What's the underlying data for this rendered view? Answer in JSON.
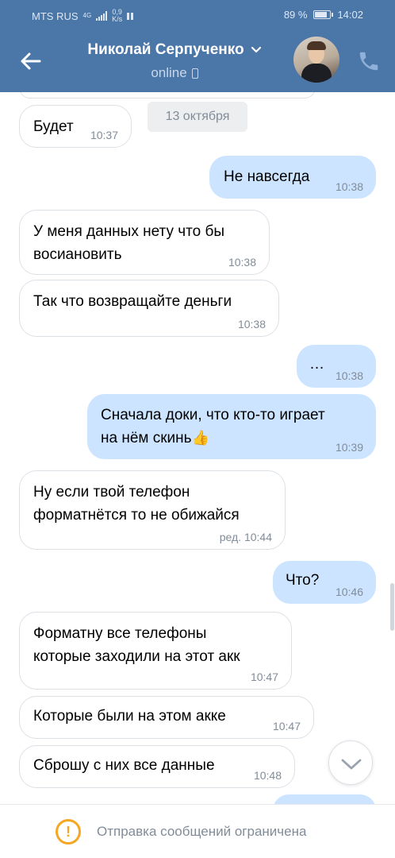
{
  "status_bar": {
    "carrier": "MTS RUS",
    "network": "4G",
    "speed_value": "0,9",
    "speed_unit": "K/s",
    "battery": "89 %",
    "battery_level": 0.89,
    "time": "14:02"
  },
  "header": {
    "contact_name": "Николай Серпученко",
    "status": "online"
  },
  "date_separator": "13 октября",
  "messages": [
    {
      "text": "Будет",
      "time": "10:37"
    },
    {
      "text": "Не навсегда",
      "time": "10:38"
    },
    {
      "text": "У меня данных нету что бы\nвосиановить",
      "time": "10:38"
    },
    {
      "text": "Так что возвращайте деньги",
      "time": "10:38"
    },
    {
      "text": "…",
      "time": "10:38"
    },
    {
      "text": "Сначала доки, что кто-то играет\nна нём скинь",
      "emoji": "👍",
      "time": "10:39"
    },
    {
      "text": "Ну если твой телефон\nформатнётся то не обижайся",
      "time": "ред. 10:44"
    },
    {
      "text": "Что?",
      "time": "10:46"
    },
    {
      "text": "Форматну все телефоны\nкоторые заходили на этот акк",
      "time": "10:47"
    },
    {
      "text": "Которые были на этом акке",
      "time": "10:47"
    },
    {
      "text": "Сброшу с них все данные",
      "time": "10:48"
    }
  ],
  "footer": {
    "notice": "Отправка сообщений ограничена"
  },
  "colors": {
    "header_bg": "#4a76a8",
    "outgoing_bubble": "#cce4ff",
    "incoming_border": "#dce1e6",
    "warning": "#f5a623"
  }
}
